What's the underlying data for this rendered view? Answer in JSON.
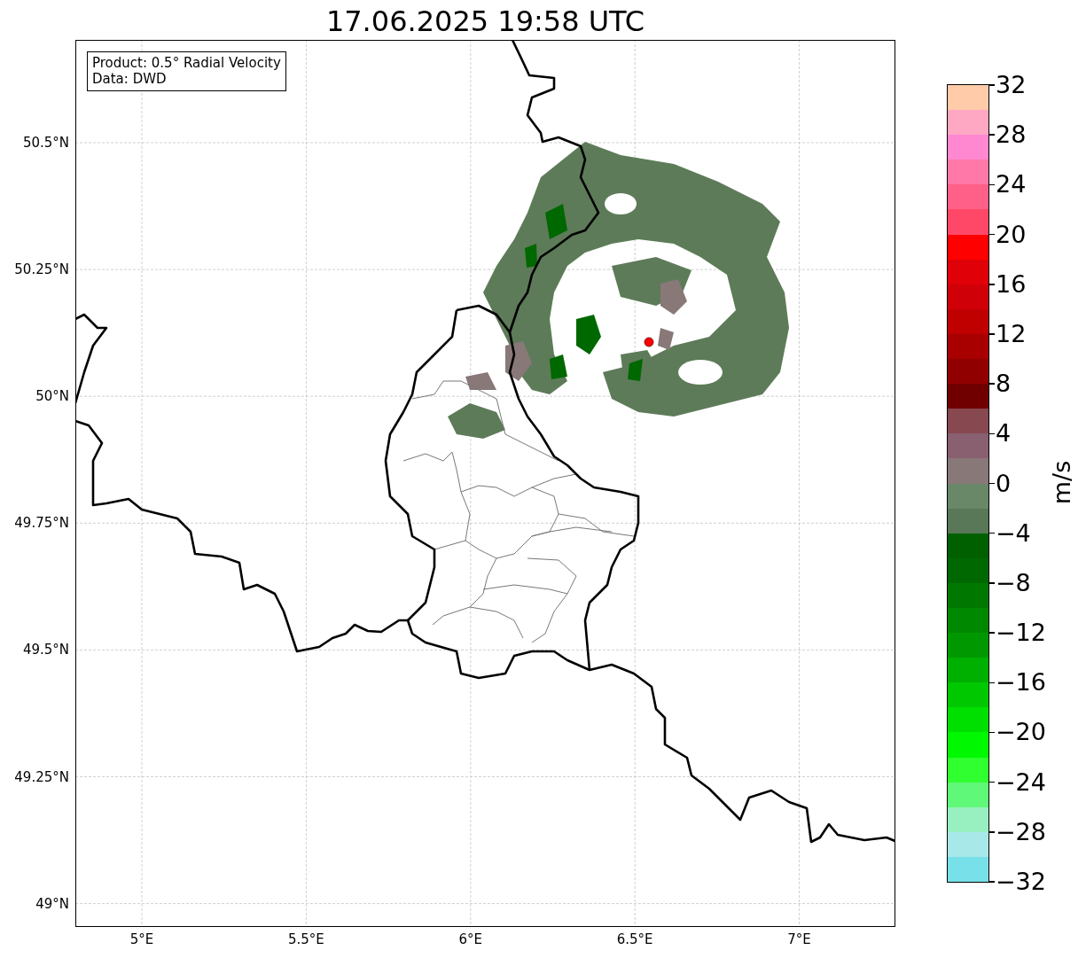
{
  "title": "17.06.2025 19:58 UTC",
  "map": {
    "info_box": {
      "product": "Product: 0.5° Radial Velocity",
      "data": "Data: DWD"
    },
    "y_ticks": [
      "50.5°N",
      "50.25°N",
      "50°N",
      "49.75°N",
      "49.5°N",
      "49.25°N",
      "49°N"
    ],
    "x_ticks": [
      "5°E",
      "5.5°E",
      "6°E",
      "6.5°E",
      "7°E"
    ]
  },
  "colorbar": {
    "label": "m/s",
    "ticks": [
      "32",
      "28",
      "24",
      "20",
      "16",
      "12",
      "8",
      "4",
      "0",
      "−4",
      "−8",
      "−12",
      "−16",
      "−20",
      "−24",
      "−28",
      "−32"
    ],
    "bands": [
      {
        "color": "#ffcba8"
      },
      {
        "color": "#ffa8c4"
      },
      {
        "color": "#ff88d0"
      },
      {
        "color": "#ff78a8"
      },
      {
        "color": "#ff6088"
      },
      {
        "color": "#ff4868"
      },
      {
        "color": "#ff0000"
      },
      {
        "color": "#e00008"
      },
      {
        "color": "#d00008"
      },
      {
        "color": "#c00000"
      },
      {
        "color": "#a80000"
      },
      {
        "color": "#900000"
      },
      {
        "color": "#700000"
      },
      {
        "color": "#884850"
      },
      {
        "color": "#886070"
      },
      {
        "color": "#887878"
      },
      {
        "color": "#688868"
      },
      {
        "color": "#587858"
      },
      {
        "color": "#006000"
      },
      {
        "color": "#006800"
      },
      {
        "color": "#007800"
      },
      {
        "color": "#008800"
      },
      {
        "color": "#009800"
      },
      {
        "color": "#00b000"
      },
      {
        "color": "#00c800"
      },
      {
        "color": "#00e000"
      },
      {
        "color": "#00f800"
      },
      {
        "color": "#30ff30"
      },
      {
        "color": "#60f878"
      },
      {
        "color": "#98f0c0"
      },
      {
        "color": "#a8e8e8"
      },
      {
        "color": "#78e0e8"
      }
    ]
  }
}
